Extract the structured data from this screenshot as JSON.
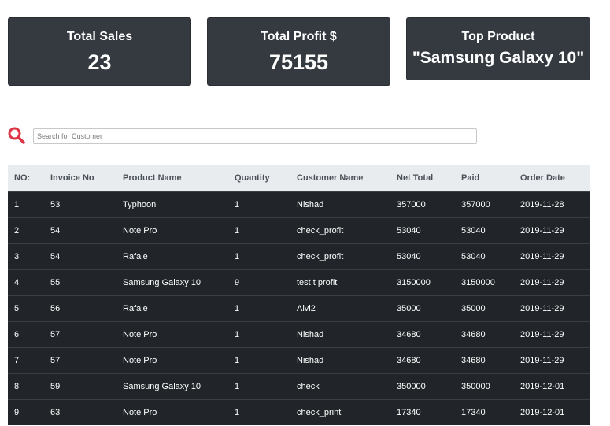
{
  "stats": {
    "total_sales": {
      "label": "Total Sales",
      "value": "23"
    },
    "total_profit": {
      "label": "Total Profit $",
      "value": "75155"
    },
    "top_product": {
      "label": "Top Product",
      "value": "\"Samsung Galaxy 10\""
    }
  },
  "search": {
    "placeholder": "Search for Customer",
    "value": "",
    "icon": "search-icon",
    "icon_color": "#dc3545"
  },
  "colors": {
    "card_bg": "#343a40",
    "table_header_bg": "#e9ecef",
    "table_body_bg": "#212529"
  },
  "table": {
    "headers": [
      "NO:",
      "Invoice No",
      "Product Name",
      "Quantity",
      "Customer Name",
      "Net Total",
      "Paid",
      "Order Date"
    ],
    "rows": [
      [
        "1",
        "53",
        "Typhoon",
        "1",
        "Nishad",
        "357000",
        "357000",
        "2019-11-28"
      ],
      [
        "2",
        "54",
        "Note Pro",
        "1",
        "check_profit",
        "53040",
        "53040",
        "2019-11-29"
      ],
      [
        "3",
        "54",
        "Rafale",
        "1",
        "check_profit",
        "53040",
        "53040",
        "2019-11-29"
      ],
      [
        "4",
        "55",
        "Samsung Galaxy 10",
        "9",
        "test t profit",
        "3150000",
        "3150000",
        "2019-11-29"
      ],
      [
        "5",
        "56",
        "Rafale",
        "1",
        "Alvi2",
        "35000",
        "35000",
        "2019-11-29"
      ],
      [
        "6",
        "57",
        "Note Pro",
        "1",
        "Nishad",
        "34680",
        "34680",
        "2019-11-29"
      ],
      [
        "7",
        "57",
        "Note Pro",
        "1",
        "Nishad",
        "34680",
        "34680",
        "2019-11-29"
      ],
      [
        "8",
        "59",
        "Samsung Galaxy 10",
        "1",
        "check",
        "350000",
        "350000",
        "2019-12-01"
      ],
      [
        "9",
        "63",
        "Note Pro",
        "1",
        "check_print",
        "17340",
        "17340",
        "2019-12-01"
      ]
    ]
  }
}
